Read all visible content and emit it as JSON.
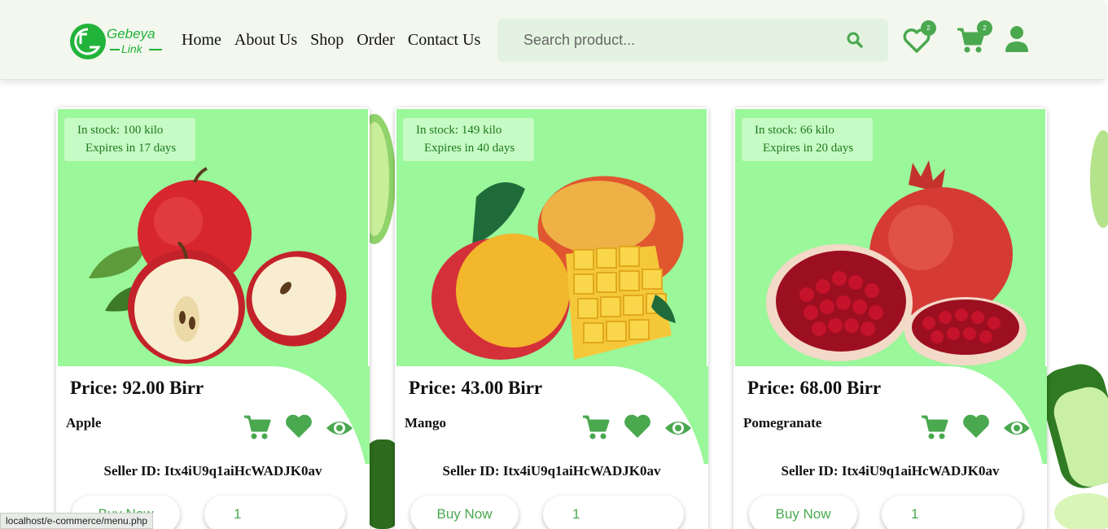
{
  "brand": {
    "logo_line1": "Gebeya",
    "logo_line2": "Link",
    "color": "#22b33a"
  },
  "nav": [
    {
      "label": "Home"
    },
    {
      "label": "About Us"
    },
    {
      "label": "Shop"
    },
    {
      "label": "Order"
    },
    {
      "label": "Contact Us"
    }
  ],
  "search": {
    "placeholder": "Search product...",
    "value": ""
  },
  "header_icons": {
    "wishlist": {
      "icon": "heart-outline-icon",
      "count": "2"
    },
    "cart": {
      "icon": "cart-icon",
      "count": "2"
    },
    "account": {
      "icon": "user-icon"
    }
  },
  "colors": {
    "accent": "#4aa84f",
    "card_media": "#9af79a",
    "stock_badge": "#c7fbc5",
    "header_bg": "#f3f7ee"
  },
  "products": [
    {
      "stock": "In stock: 100 kilo",
      "expires": "Expires in 17 days",
      "price": "Price: 92.00 Birr",
      "name": "Apple",
      "seller": "Seller ID: Itx4iU9q1aiHcWADJK0av",
      "buy_label": "Buy Now",
      "quantity": "1"
    },
    {
      "stock": "In stock: 149 kilo",
      "expires": "Expires in 40 days",
      "price": "Price: 43.00 Birr",
      "name": "Mango",
      "seller": "Seller ID: Itx4iU9q1aiHcWADJK0av",
      "buy_label": "Buy Now",
      "quantity": "1"
    },
    {
      "stock": "In stock: 66 kilo",
      "expires": "Expires in 20 days",
      "price": "Price: 68.00 Birr",
      "name": "Pomegranate",
      "seller": "Seller ID: Itx4iU9q1aiHcWADJK0av",
      "buy_label": "Buy Now",
      "quantity": "1"
    }
  ],
  "status_url": "localhost/e-commerce/menu.php"
}
